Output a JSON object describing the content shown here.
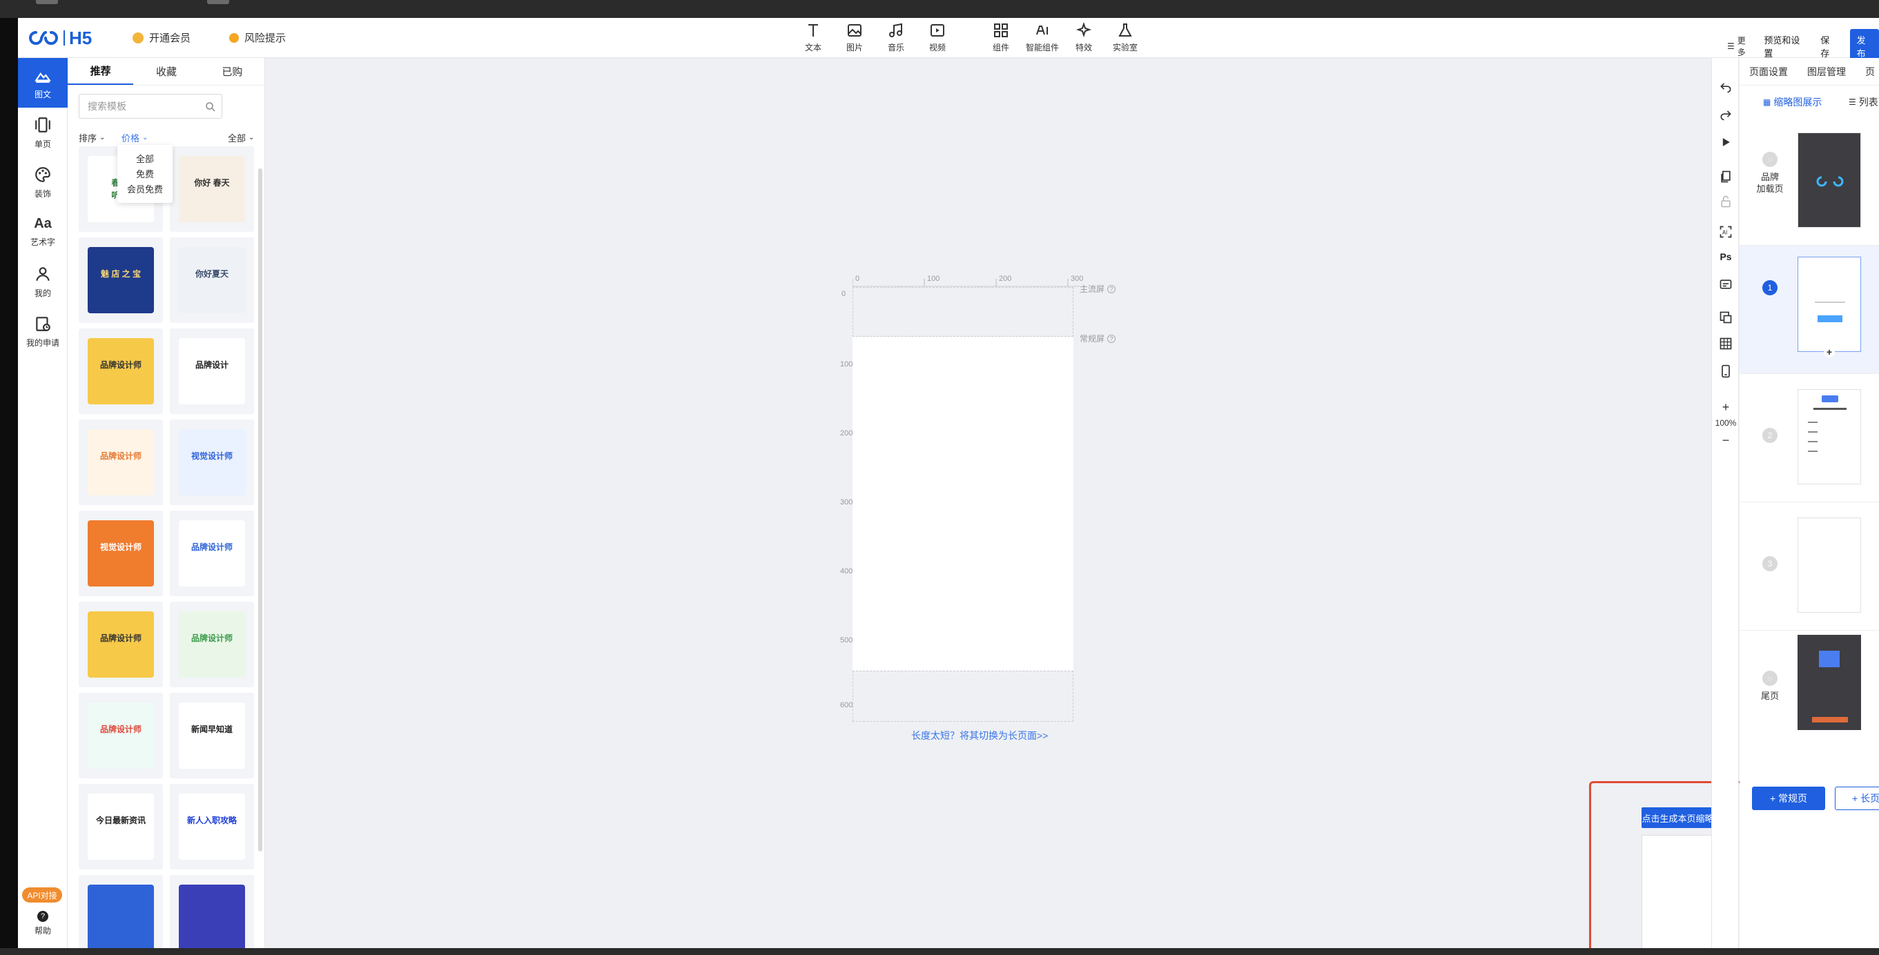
{
  "header": {
    "logo_text": "H5",
    "vip_label": "开通会员",
    "risk_label": "风险提示",
    "tools": [
      "文本",
      "图片",
      "音乐",
      "视频"
    ],
    "tools2": [
      "组件",
      "智能组件",
      "特效",
      "实验室"
    ],
    "more_label": "更多",
    "preview_label": "预览和设置",
    "save_label": "保存",
    "publish_label": "发布"
  },
  "leftnav": {
    "items": [
      "图文",
      "单页",
      "装饰",
      "艺术字",
      "我的",
      "我的申请"
    ],
    "api_label": "API对接",
    "help_label": "帮助"
  },
  "panel": {
    "tabs": [
      "推荐",
      "收藏",
      "已购"
    ],
    "search_placeholder": "搜索模板",
    "sort_label": "排序",
    "price_label": "价格",
    "all_label": "全部",
    "price_options": [
      "全部",
      "免费",
      "会员免费"
    ]
  },
  "templates": [
    {
      "text": "春 暖\n听 花",
      "bg": "#ffffff",
      "fg": "#2e7d3a"
    },
    {
      "text": "你好 春天",
      "bg": "#f7efe4",
      "fg": "#333"
    },
    {
      "text": "魅 店 之 宝",
      "bg": "#1e3a8a",
      "fg": "#f7d774"
    },
    {
      "text": "你好夏天",
      "bg": "#eef2f6",
      "fg": "#3a4a6a"
    },
    {
      "text": "品牌设计师",
      "bg": "#f7c948",
      "fg": "#333"
    },
    {
      "text": "品牌设计",
      "bg": "#ffffff",
      "fg": "#222"
    },
    {
      "text": "品牌设计师",
      "bg": "#fff4e6",
      "fg": "#e6792f"
    },
    {
      "text": "视觉设计师",
      "bg": "#eaf1ff",
      "fg": "#2e63d8"
    },
    {
      "text": "视觉设计师",
      "bg": "#f07c2e",
      "fg": "#fff"
    },
    {
      "text": "品牌设计师",
      "bg": "#ffffff",
      "fg": "#2e63d8"
    },
    {
      "text": "品牌设计师",
      "bg": "#f7c948",
      "fg": "#333"
    },
    {
      "text": "品牌设计师",
      "bg": "#eaf7e8",
      "fg": "#3a9a4a"
    },
    {
      "text": "品牌设计师",
      "bg": "#eefaf6",
      "fg": "#e0483a"
    },
    {
      "text": "新闻早知道",
      "bg": "#ffffff",
      "fg": "#222"
    },
    {
      "text": "今日最新资讯",
      "bg": "#ffffff",
      "fg": "#222"
    },
    {
      "text": "新人入职攻略",
      "bg": "#ffffff",
      "fg": "#1f3fd6"
    },
    {
      "text": "",
      "bg": "#2e63d8",
      "fg": "#fff"
    },
    {
      "text": "",
      "bg": "#3a3fb8",
      "fg": "#fff"
    }
  ],
  "canvas": {
    "ruler_h": [
      "0",
      "100",
      "200",
      "300"
    ],
    "ruler_v": [
      "0",
      "100",
      "200",
      "300",
      "400",
      "500",
      "600"
    ],
    "main_screen_label": "主流屏",
    "normal_screen_label": "常规屏",
    "switch_link": "长度太短？将其切换为长页面>>"
  },
  "rtool": {
    "zoom": "100%"
  },
  "rpanel": {
    "tabs": [
      "页面设置",
      "图层管理",
      "页"
    ],
    "thumb_view_label": "缩略图展示",
    "list_view_label": "列表",
    "pages": [
      {
        "num": "",
        "label": "品牌\n加载页",
        "active": false
      },
      {
        "num": "1",
        "label": "",
        "active": true
      },
      {
        "num": "2",
        "label": "",
        "active": false
      },
      {
        "num": "3",
        "label": "",
        "active": false
      },
      {
        "num": "",
        "label": "尾页",
        "active": false
      }
    ],
    "add_normal_label": "+ 常规页",
    "add_long_label": "+ 长页"
  },
  "generate": {
    "button_label": "点击生成本页缩略图"
  },
  "colors": {
    "primary": "#1f5fe0",
    "highlight": "#e04b36",
    "api": "#f08c2e"
  }
}
